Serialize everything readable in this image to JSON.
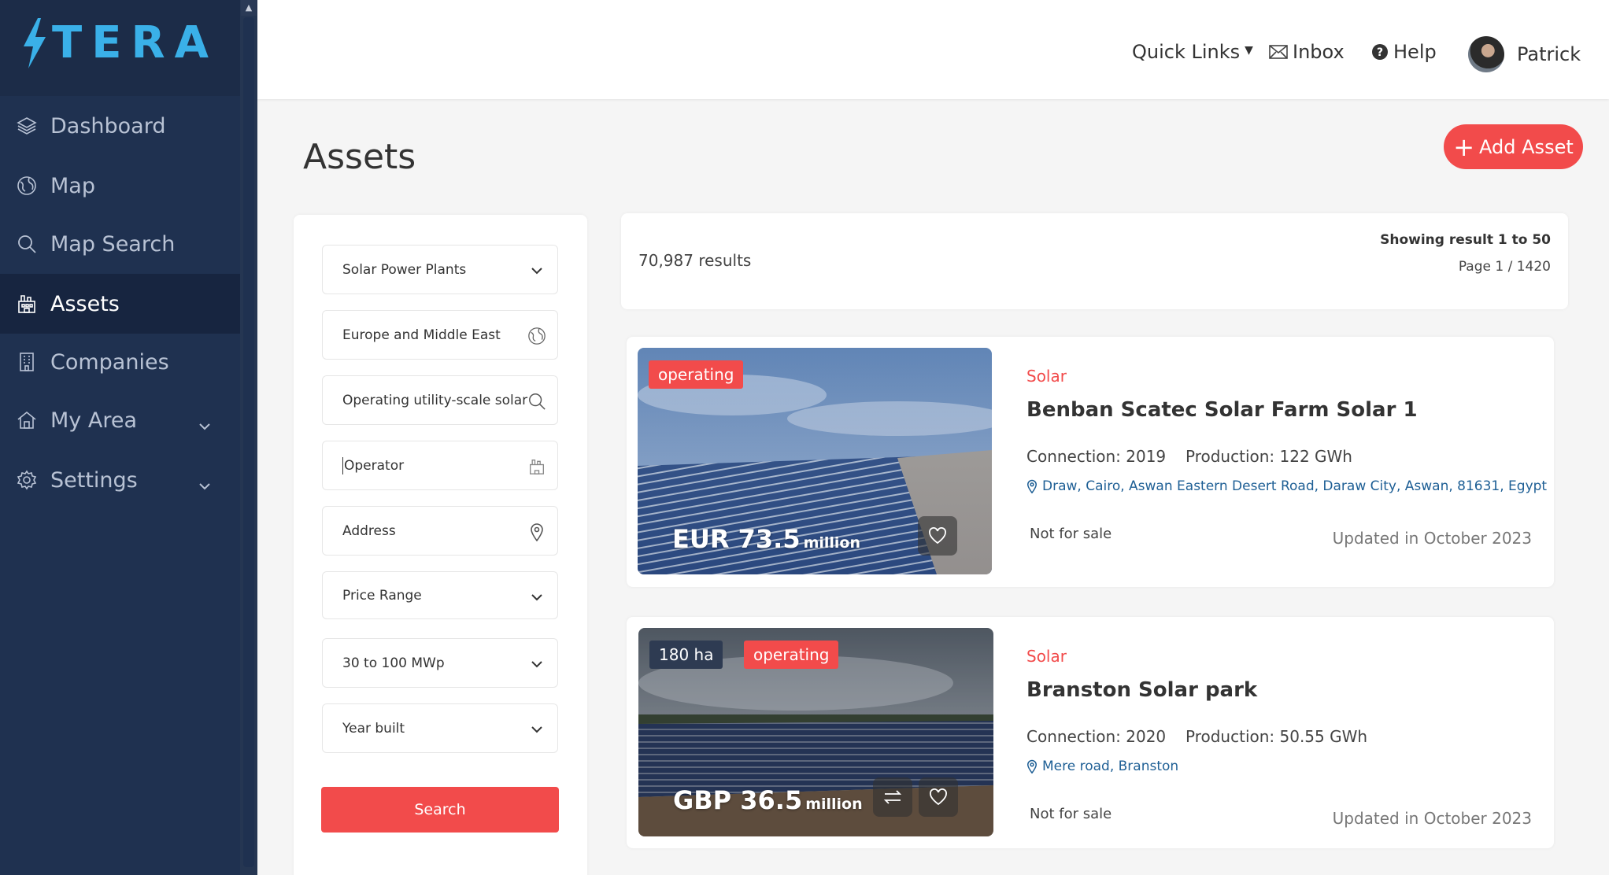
{
  "brand": {
    "name": "TERA",
    "reg": "®"
  },
  "sidebar": {
    "items": [
      {
        "label": "Dashboard",
        "icon": "layers-icon"
      },
      {
        "label": "Map",
        "icon": "globe-icon"
      },
      {
        "label": "Map Search",
        "icon": "search-icon"
      },
      {
        "label": "Assets",
        "icon": "factory-icon",
        "active": true
      },
      {
        "label": "Companies",
        "icon": "building-icon"
      },
      {
        "label": "My Area",
        "icon": "home-icon",
        "expandable": true
      },
      {
        "label": "Settings",
        "icon": "gear-icon",
        "expandable": true
      }
    ]
  },
  "header": {
    "quick_links": "Quick Links",
    "inbox": "Inbox",
    "help": "Help",
    "user": "Patrick"
  },
  "page": {
    "title": "Assets",
    "add_button": "Add Asset"
  },
  "filters": {
    "asset_type": "Solar Power Plants",
    "region": "Europe and Middle East",
    "keyword": "Operating utility-scale solar",
    "operator_placeholder": "Operator",
    "address_placeholder": "Address",
    "price_range": "Price Range",
    "capacity": "30 to 100 MWp",
    "year_built": "Year built",
    "search_label": "Search"
  },
  "results": {
    "count": "70,987 results",
    "showing": "Showing result 1 to 50",
    "page": "Page 1 / 1420"
  },
  "assets": [
    {
      "status": "operating",
      "price_value": "EUR 73.5",
      "price_unit": "million",
      "category": "Solar",
      "name": "Benban Scatec Solar Farm Solar 1",
      "connection": "Connection: 2019",
      "production": "Production: 122 GWh",
      "address": "Draw, Cairo, Aswan Eastern Desert Road, Daraw City, Aswan, 81631, Egypt",
      "sale_status": "Not for sale",
      "updated": "Updated in October 2023"
    },
    {
      "area": "180 ha",
      "status": "operating",
      "price_value": "GBP 36.5",
      "price_unit": "million",
      "category": "Solar",
      "name": "Branston Solar park",
      "connection": "Connection: 2020",
      "production": "Production: 50.55 GWh",
      "address": "Mere road, Branston",
      "sale_status": "Not for sale",
      "updated": "Updated in October 2023"
    }
  ],
  "colors": {
    "sidebar": "#1f3150",
    "accent": "#f24b4b",
    "link": "#1e5f95",
    "brand": "#3ab0e8"
  }
}
